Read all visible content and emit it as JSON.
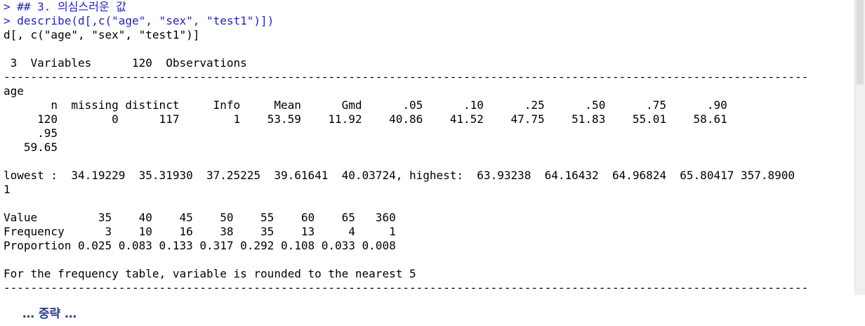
{
  "console": {
    "lines": [
      {
        "kind": "input",
        "text": "> ## 3. 의심스러운 값"
      },
      {
        "kind": "input",
        "text": "> describe(d[,c(\"age\", \"sex\", \"test1\")])"
      },
      {
        "kind": "output",
        "text": "d[, c(\"age\", \"sex\", \"test1\")]"
      },
      {
        "kind": "output",
        "text": ""
      },
      {
        "kind": "output",
        "text": " 3  Variables      120  Observations"
      },
      {
        "kind": "output",
        "text": "-----------------------------------------------------------------------------------------------------------------------"
      },
      {
        "kind": "output",
        "text": "age"
      },
      {
        "kind": "output",
        "text": "       n  missing distinct     Info     Mean      Gmd      .05      .10      .25      .50      .75      .90"
      },
      {
        "kind": "output",
        "text": "     120        0      117        1    53.59    11.92    40.86    41.52    47.75    51.83    55.01    58.61"
      },
      {
        "kind": "output",
        "text": "     .95"
      },
      {
        "kind": "output",
        "text": "   59.65"
      },
      {
        "kind": "output",
        "text": ""
      },
      {
        "kind": "output",
        "text": "lowest :  34.19229  35.31930  37.25225  39.61641  40.03724, highest:  63.93238  64.16432  64.96824  65.80417 357.8900"
      },
      {
        "kind": "output",
        "text": "1"
      },
      {
        "kind": "output",
        "text": ""
      },
      {
        "kind": "output",
        "text": "Value         35    40    45    50    55    60    65   360"
      },
      {
        "kind": "output",
        "text": "Frequency      3    10    16    38    35    13     4     1"
      },
      {
        "kind": "output",
        "text": "Proportion 0.025 0.083 0.133 0.317 0.292 0.108 0.033 0.008"
      },
      {
        "kind": "output",
        "text": ""
      },
      {
        "kind": "output",
        "text": "For the frequency table, variable is rounded to the nearest 5"
      },
      {
        "kind": "output",
        "text": "-----------------------------------------------------------------------------------------------------------------------"
      }
    ]
  },
  "note": {
    "text": "… 중략 …"
  },
  "colors": {
    "input_text": "#1f1fcf",
    "output_text": "#000000",
    "note_text": "#2d3f8f"
  }
}
